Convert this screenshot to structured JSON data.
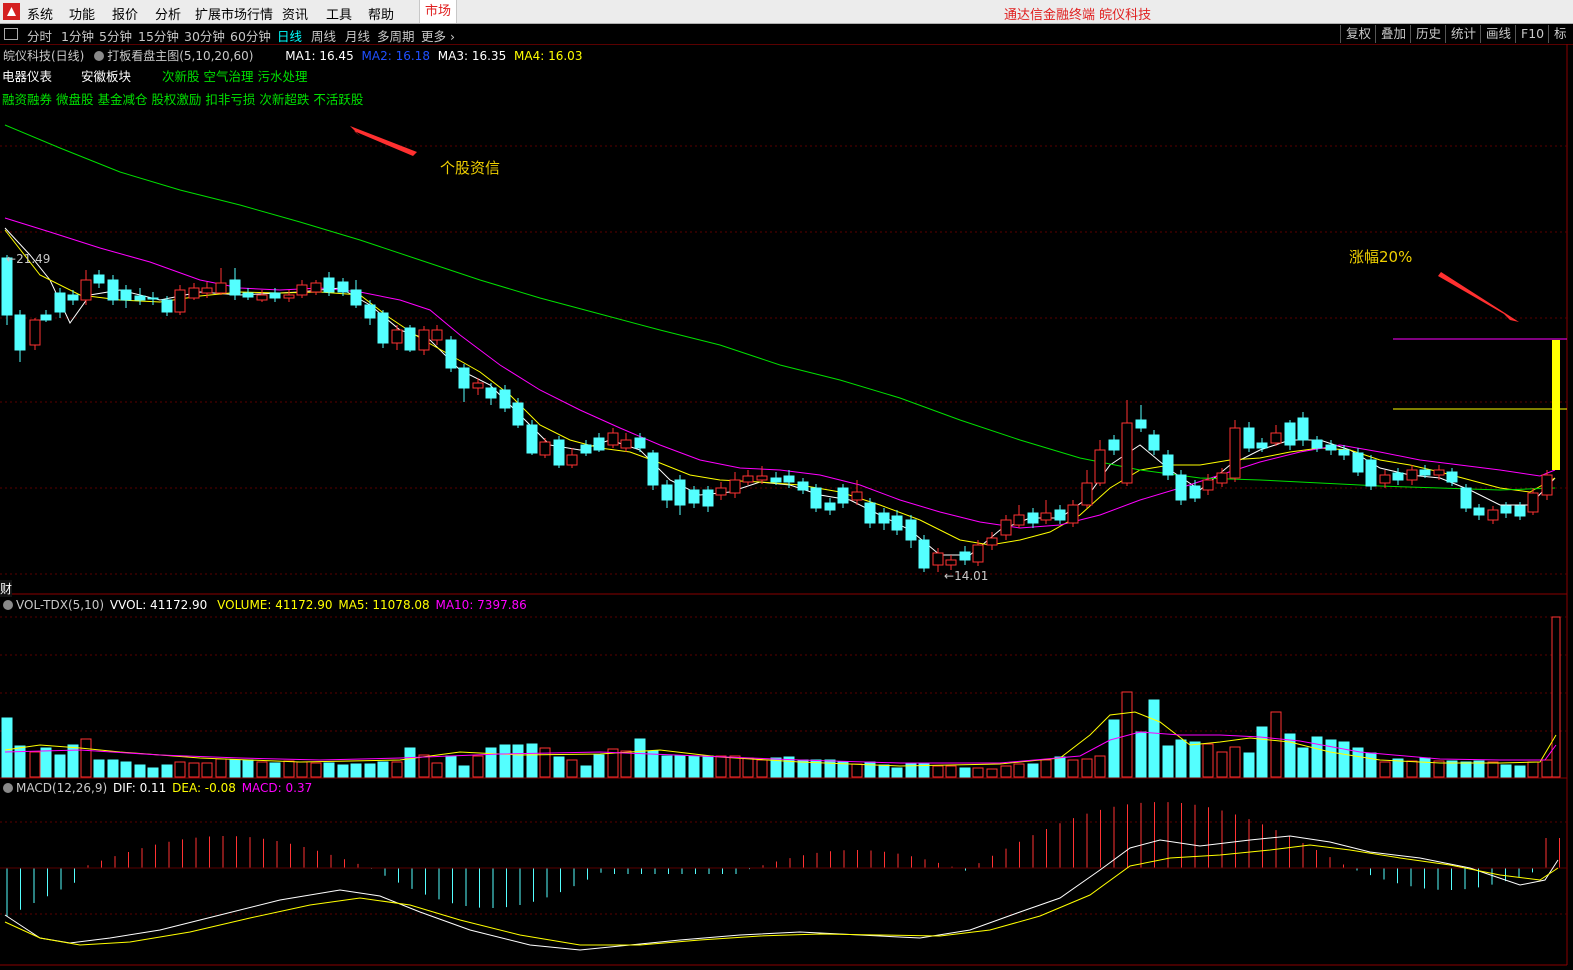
{
  "menubar": {
    "items": [
      "系统",
      "功能",
      "报价",
      "分析",
      "扩展市场行情",
      "资讯",
      "工具",
      "帮助"
    ],
    "market_tab": "市场",
    "terminal_title": "通达信金融终端 皖仪科技"
  },
  "period_bar": {
    "items": [
      "分时",
      "1分钟",
      "5分钟",
      "15分钟",
      "30分钟",
      "60分钟",
      "日线",
      "周线",
      "月线",
      "多周期",
      "更多"
    ],
    "active": "日线",
    "right_tools": [
      "复权",
      "叠加",
      "历史",
      "统计",
      "画线",
      "F10",
      "标"
    ]
  },
  "main_chart": {
    "stock_title": "皖仪科技(日线)",
    "indicator_name": "打板看盘主图(5,10,20,60)",
    "ma1": "MA1: 16.45",
    "ma2": "MA2: 16.18",
    "ma3": "MA3: 16.35",
    "ma4": "MA4: 16.03",
    "industry": "电器仪表",
    "region": "安徽板块",
    "concepts": "次新股 空气治理 污水处理",
    "tags": "融资融券 微盘股 基金减仓 股权激励 扣非亏损 次新超跌 不活跃股",
    "high_label": "21.49",
    "low_label": "14.01",
    "annotation_info": "个股资信",
    "annotation_limit": "涨幅20%"
  },
  "volume_panel": {
    "name": "VOL-TDX(5,10)",
    "vvol": "VVOL: 41172.90",
    "volume": "VOLUME: 41172.90",
    "ma5": "MA5: 11078.08",
    "ma10": "MA10: 7397.86"
  },
  "macd_panel": {
    "name": "MACD(12,26,9)",
    "dif": "DIF: 0.11",
    "dea": "DEA: -0.08",
    "macd": "MACD: 0.37"
  },
  "side_label": "财",
  "colors": {
    "up": "#ff3232",
    "down": "#54ffff",
    "ma1": "#ffffff",
    "ma2": "#ffff00",
    "ma3": "#ff00ff",
    "ma4": "#00e000",
    "grid": "#5a0000",
    "text_yellow": "#f0d000"
  }
}
